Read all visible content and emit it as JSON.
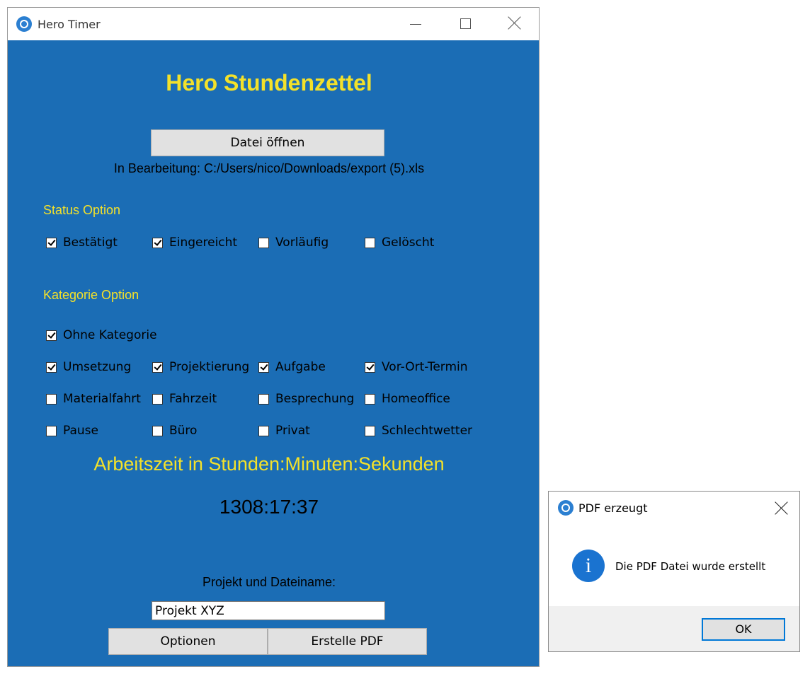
{
  "main_window": {
    "title": "Hero Timer",
    "app_title": "Hero Stundenzettel",
    "open_button": "Datei öffnen",
    "editing_text": "In Bearbeitung: C:/Users/nico/Downloads/export (5).xls",
    "status_section": {
      "label": "Status Option",
      "options": [
        {
          "label": "Bestätigt",
          "checked": true
        },
        {
          "label": "Eingereicht",
          "checked": true
        },
        {
          "label": "Vorläufig",
          "checked": false
        },
        {
          "label": "Gelöscht",
          "checked": false
        }
      ]
    },
    "category_section": {
      "label": "Kategorie Option",
      "options": [
        {
          "label": "Ohne Kategorie",
          "checked": true
        },
        {
          "label": "Umsetzung",
          "checked": true
        },
        {
          "label": "Projektierung",
          "checked": true
        },
        {
          "label": "Aufgabe",
          "checked": true
        },
        {
          "label": "Vor-Ort-Termin",
          "checked": true
        },
        {
          "label": "Materialfahrt",
          "checked": false
        },
        {
          "label": "Fahrzeit",
          "checked": false
        },
        {
          "label": "Besprechung",
          "checked": false
        },
        {
          "label": "Homeoffice",
          "checked": false
        },
        {
          "label": "Pause",
          "checked": false
        },
        {
          "label": "Büro",
          "checked": false
        },
        {
          "label": "Privat",
          "checked": false
        },
        {
          "label": "Schlechtwetter",
          "checked": false
        }
      ]
    },
    "worktime_label": "Arbeitszeit in Stunden:Minuten:Sekunden",
    "worktime_value": "1308:17:37",
    "project_label": "Projekt und Dateiname:",
    "project_value": "Projekt XYZ",
    "options_button": "Optionen",
    "pdf_button": "Erstelle PDF"
  },
  "dialog": {
    "title": "PDF erzeugt",
    "message": "Die PDF Datei wurde erstellt",
    "ok_button": "OK"
  },
  "colors": {
    "window_background": "#1b6db5",
    "heading_yellow": "#f3e12a",
    "info_blue": "#1a73d0"
  }
}
